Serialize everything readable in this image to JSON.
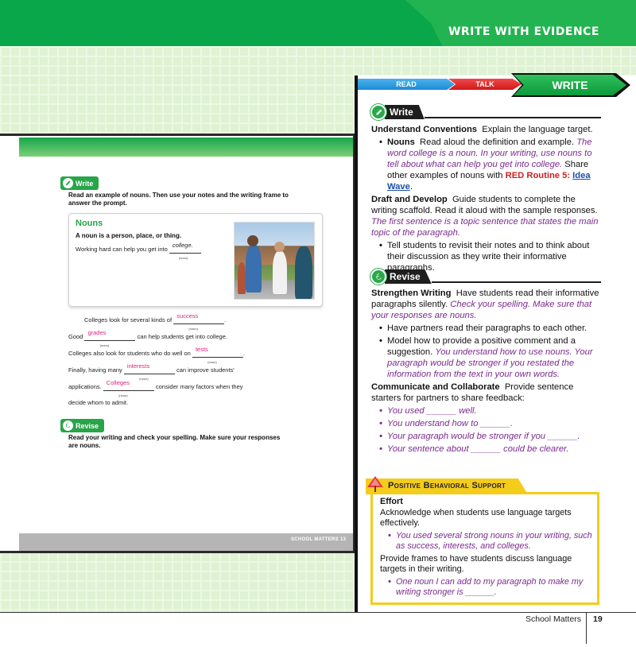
{
  "header": {
    "title": "WRITE WITH EVIDENCE"
  },
  "steps": {
    "read": "READ",
    "talk": "TALK",
    "write": "WRITE"
  },
  "student": {
    "write_tab": "Write",
    "instructions": "Read an example of nouns. Then use your notes and the writing frame to answer the prompt.",
    "nouns_title": "Nouns",
    "nouns_def": "A noun is a person, place, or thing.",
    "example_prefix": "Working hard can help you get into",
    "example_word": "college.",
    "noun_tag": "(noun)",
    "frame": [
      {
        "before": "Colleges look for several kinds of",
        "answer": "success",
        "after": "."
      },
      {
        "before": "Good",
        "answer": "grades",
        "after": "can help students get into college."
      },
      {
        "before": "Colleges also look for students who do well on",
        "answer": "tests",
        "after": "."
      },
      {
        "before": "Finally, having many",
        "answer": "interests",
        "after": "can improve students'"
      },
      {
        "before": "applications.",
        "answer": "Colleges",
        "after": "consider many factors when they"
      }
    ],
    "frame_last": "decide whom to admit.",
    "revise_tab": "Revise",
    "revise_text": "Read your writing and check your spelling. Make sure your responses are nouns.",
    "footer": "SCHOOL MATTERS   13"
  },
  "teacher": {
    "write_heading": "Write",
    "uc_label": "Understand Conventions",
    "uc_text": "Explain the language target.",
    "nouns_label": "Nouns",
    "nouns_text": "Read aloud the definition and example.",
    "nouns_italic": "The word college is a noun. In your writing, use nouns to tell about what can help you get into college.",
    "nouns_share": "Share other examples of nouns with",
    "routine": "RED Routine 5:",
    "idea_wave": "Idea Wave",
    "dd_label": "Draft and Develop",
    "dd_text": "Guide students to complete the writing scaffold. Read it aloud with the sample responses.",
    "dd_italic": "The first sentence is a topic sentence that states the main topic of the paragraph.",
    "dd_bullet": "Tell students to revisit their notes and to think about their discussion as they write their informative paragraphs.",
    "revise_heading": "Revise",
    "sw_label": "Strengthen Writing",
    "sw_text": "Have students read their informative paragraphs silently.",
    "sw_italic": "Check your spelling. Make sure that your responses are nouns.",
    "sw_b1": "Have partners read their paragraphs to each other.",
    "sw_b2": "Model how to provide a positive comment and a suggestion.",
    "sw_b2_italic": "You understand how to use nouns. Your paragraph would be stronger if you restated the information from the text in your own words.",
    "cc_label": "Communicate and Collaborate",
    "cc_text": "Provide sentence starters for partners to share feedback:",
    "frames": [
      "You used ______ well.",
      "You understand how to ______.",
      "Your paragraph would be stronger if you ______.",
      "Your sentence about ______ could be clearer."
    ],
    "pbs_title": "Positive Behavioral Support",
    "effort": "Effort",
    "effort_text": "Acknowledge when students use language targets effectively.",
    "effort_italic": "You used several strong nouns in your writing, such as success, interests, and colleges.",
    "frames_text": "Provide frames to have students discuss language targets in their writing.",
    "frames_italic": "One noun I can add to my paragraph to make my writing stronger is ______."
  },
  "footer": {
    "book": "School Matters",
    "page": "19"
  },
  "colors": {
    "green": "#0aa64a",
    "purple": "#7b2a8f",
    "yellow": "#f4cc1c",
    "magenta": "#e0227e"
  }
}
